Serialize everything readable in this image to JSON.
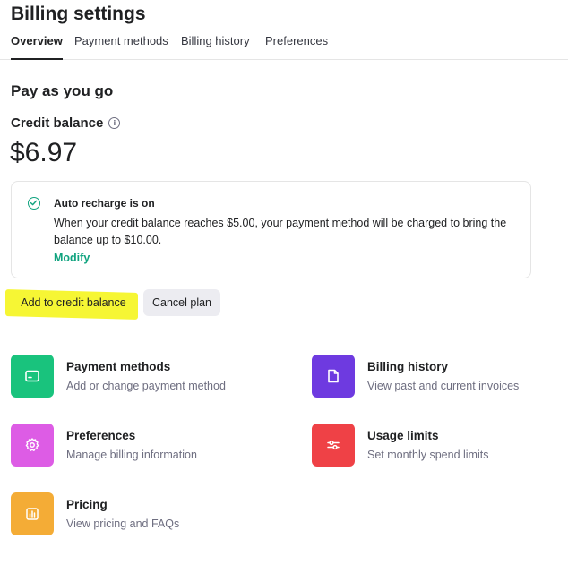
{
  "header": {
    "title": "Billing settings"
  },
  "tabs": [
    {
      "label": "Overview",
      "active": true
    },
    {
      "label": "Payment methods",
      "active": false
    },
    {
      "label": "Billing history",
      "active": false
    },
    {
      "label": "Preferences",
      "active": false
    }
  ],
  "main": {
    "section_title": "Pay as you go",
    "credit_label": "Credit balance",
    "credit_info_icon": "info-icon",
    "balance": "$6.97",
    "auto_recharge": {
      "icon": "check-circle-icon",
      "title": "Auto recharge is on",
      "description": "When your credit balance reaches $5.00, your payment method will be charged to bring the balance up to $10.00.",
      "modify_label": "Modify"
    },
    "buttons": {
      "add_credit": "Add to credit balance",
      "cancel_plan": "Cancel plan"
    }
  },
  "tiles": [
    {
      "title": "Payment methods",
      "description": "Add or change payment method",
      "icon": "credit-card-icon",
      "color": "#19c37d"
    },
    {
      "title": "Billing history",
      "description": "View past and current invoices",
      "icon": "document-icon",
      "color": "#6e3ae0"
    },
    {
      "title": "Preferences",
      "description": "Manage billing information",
      "icon": "gear-icon",
      "color": "#dd5ce5"
    },
    {
      "title": "Usage limits",
      "description": "Set monthly spend limits",
      "icon": "sliders-icon",
      "color": "#ef4146"
    },
    {
      "title": "Pricing",
      "description": "View pricing and FAQs",
      "icon": "bar-chart-icon",
      "color": "#f4ac36"
    }
  ],
  "colors": {
    "accent": "#10a37f",
    "highlight": "#f5f510",
    "button_bg": "#ececf1"
  }
}
